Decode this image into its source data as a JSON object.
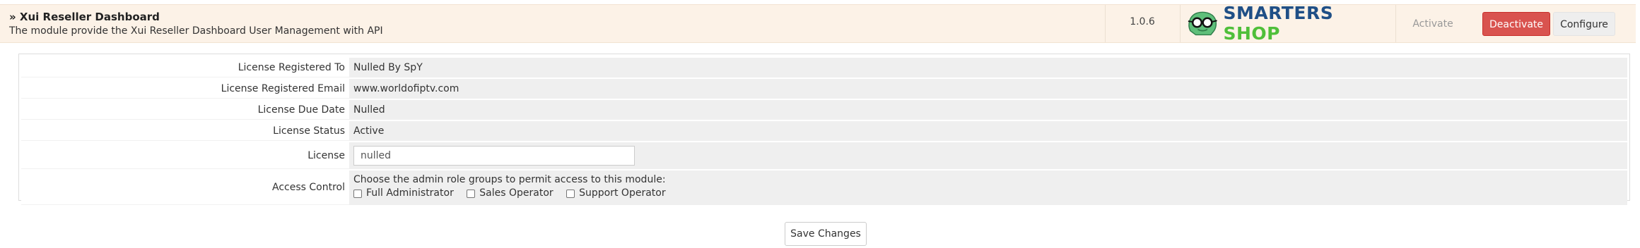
{
  "module": {
    "title": "» Xui Reseller Dashboard",
    "description": "The module provide the Xui Reseller Dashboard User Management with API",
    "version": "1.0.6",
    "logo": {
      "icon": "glasses-face-icon",
      "text_part1": "SMARTERS",
      "text_part2": "SHOP",
      "color_part1": "#1f4f86",
      "color_part2": "#4fbf3a"
    },
    "buttons": {
      "activate": "Activate",
      "deactivate": "Deactivate",
      "configure": "Configure"
    },
    "colors": {
      "row_background": "#fcf2e7",
      "deactivate": "#d9534f"
    }
  },
  "settings": {
    "license_registered_to": {
      "label": "License Registered To",
      "value": "Nulled By SpY"
    },
    "license_registered_email": {
      "label": "License Registered Email",
      "value": "www.worldofiptv.com"
    },
    "license_due_date": {
      "label": "License Due Date",
      "value": "Nulled"
    },
    "license_status": {
      "label": "License Status",
      "value": "Active"
    },
    "license": {
      "label": "License",
      "value": "nulled"
    },
    "access_control": {
      "label": "Access Control",
      "instruction": "Choose the admin role groups to permit access to this module:",
      "options": [
        {
          "label": "Full Administrator",
          "checked": false
        },
        {
          "label": "Sales Operator",
          "checked": false
        },
        {
          "label": "Support Operator",
          "checked": false
        }
      ]
    }
  },
  "save_button": "Save Changes"
}
